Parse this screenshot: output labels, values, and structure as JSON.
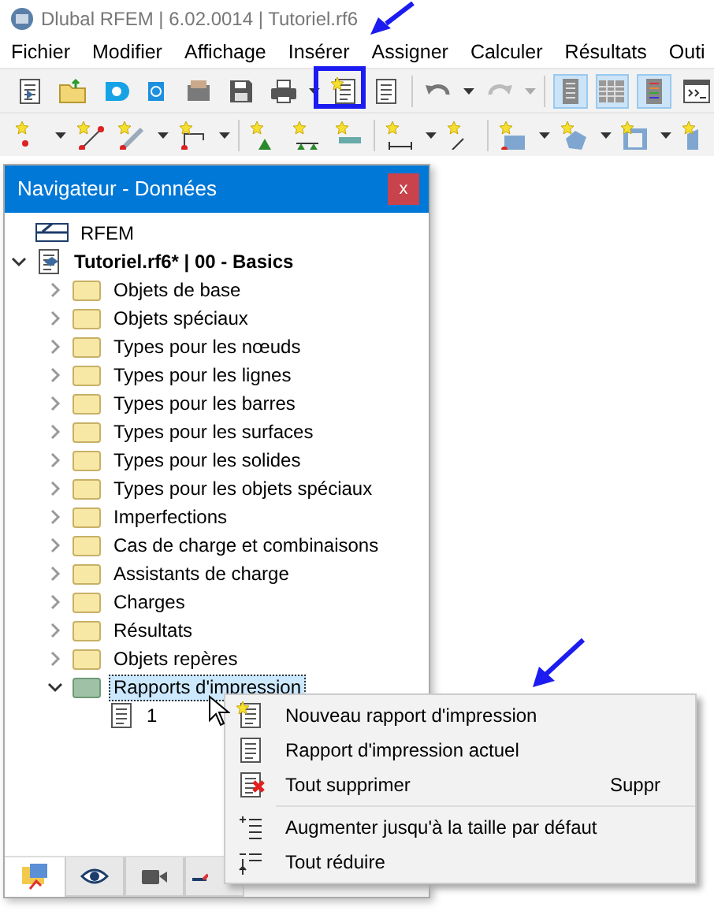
{
  "window": {
    "title": "Dlubal RFEM | 6.02.0014 | Tutoriel.rf6"
  },
  "menu_bar": [
    "Fichier",
    "Modifier",
    "Affichage",
    "Insérer",
    "Assigner",
    "Calculer",
    "Résultats",
    "Outi"
  ],
  "toolbar": {
    "view_toggles": [
      {
        "on": true
      },
      {
        "on": true
      },
      {
        "on": true
      },
      {
        "on": false
      }
    ]
  },
  "navigator": {
    "title": "Navigateur - Données",
    "close": "x",
    "tree": [
      {
        "label": "RFEM",
        "kind": "app",
        "selected": false
      },
      {
        "label": "Tutoriel.rf6* | 00 - Basics",
        "kind": "model",
        "expanded": true,
        "selected": false,
        "children": [
          {
            "label": "Objets de base",
            "kind": "folder",
            "expanded": false,
            "selected": false
          },
          {
            "label": "Objets spéciaux",
            "kind": "folder",
            "expanded": false,
            "selected": false
          },
          {
            "label": "Types pour les nœuds",
            "kind": "folder",
            "expanded": false,
            "selected": false
          },
          {
            "label": "Types pour les lignes",
            "kind": "folder",
            "expanded": false,
            "selected": false
          },
          {
            "label": "Types pour les barres",
            "kind": "folder",
            "expanded": false,
            "selected": false
          },
          {
            "label": "Types pour les surfaces",
            "kind": "folder",
            "expanded": false,
            "selected": false
          },
          {
            "label": "Types pour les solides",
            "kind": "folder",
            "expanded": false,
            "selected": false
          },
          {
            "label": "Types pour les objets spéciaux",
            "kind": "folder",
            "expanded": false,
            "selected": false
          },
          {
            "label": "Imperfections",
            "kind": "folder",
            "expanded": false,
            "selected": false
          },
          {
            "label": "Cas de charge et combinaisons",
            "kind": "folder",
            "expanded": false,
            "selected": false
          },
          {
            "label": "Assistants de charge",
            "kind": "folder",
            "expanded": false,
            "selected": false
          },
          {
            "label": "Charges",
            "kind": "folder",
            "expanded": false,
            "selected": false
          },
          {
            "label": "Résultats",
            "kind": "folder",
            "expanded": false,
            "selected": false
          },
          {
            "label": "Objets repères",
            "kind": "folder",
            "expanded": false,
            "selected": false
          },
          {
            "label": "Rapports d'impression",
            "kind": "folder",
            "expanded": true,
            "selected": true,
            "children": [
              {
                "label": "1",
                "kind": "document",
                "selected": false
              }
            ]
          }
        ]
      }
    ],
    "bottom_tabs": [
      {
        "kind": "data",
        "selected": true
      },
      {
        "kind": "view",
        "selected": false
      },
      {
        "kind": "camera",
        "selected": false
      },
      {
        "kind": "results",
        "selected": false
      }
    ]
  },
  "context_menu": [
    {
      "kind": "item",
      "label": "Nouveau rapport d'impression"
    },
    {
      "kind": "item",
      "label": "Rapport d'impression actuel"
    },
    {
      "kind": "item",
      "label": "Tout supprimer",
      "shortcut": "Suppr"
    },
    {
      "kind": "separator"
    },
    {
      "kind": "item",
      "label": "Augmenter jusqu'à la taille par défaut"
    },
    {
      "kind": "item",
      "label": "Tout réduire"
    }
  ]
}
